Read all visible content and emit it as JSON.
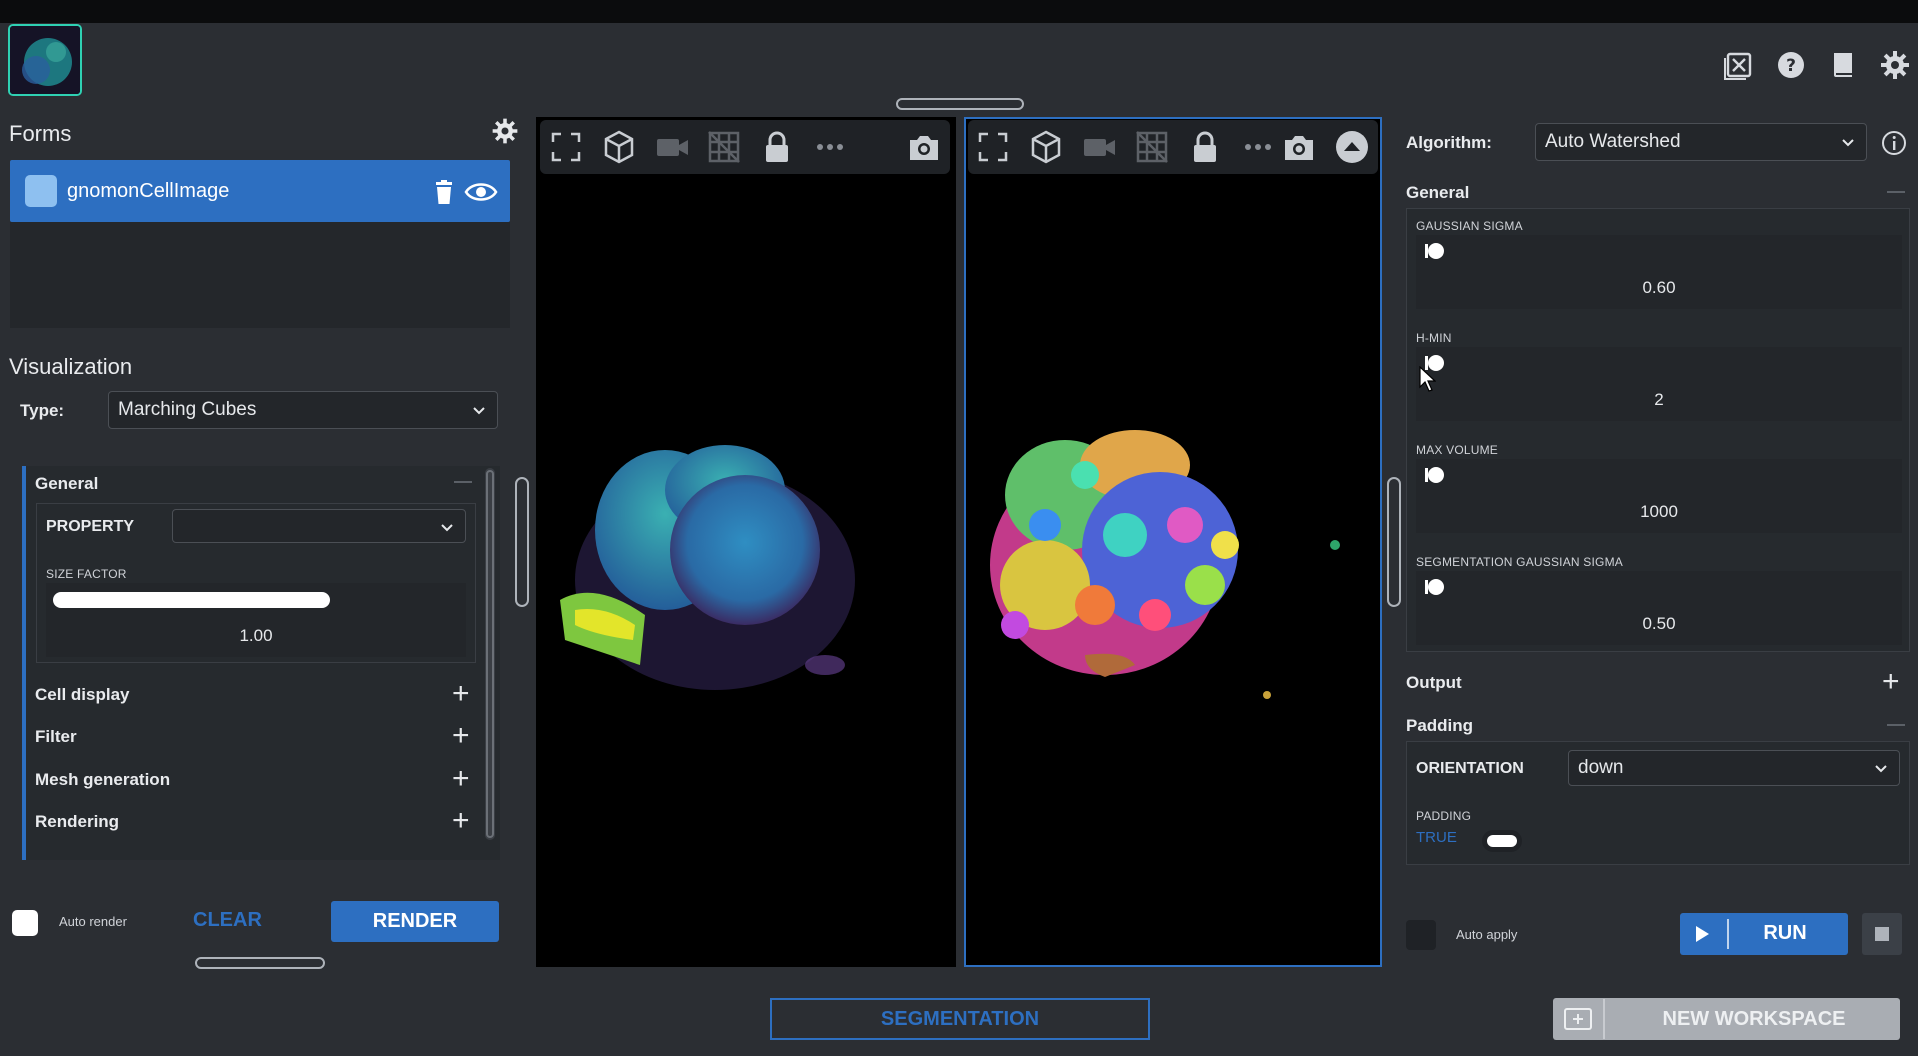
{
  "header": {
    "icons": [
      "close-workspace-icon",
      "help-icon",
      "book-icon",
      "settings-icon"
    ]
  },
  "forms": {
    "title": "Forms",
    "item_label": "gnomonCellImage"
  },
  "visualization": {
    "title": "Visualization",
    "type_label": "Type:",
    "type_value": "Marching Cubes",
    "general_title": "General",
    "property_label": "PROPERTY",
    "property_value": "",
    "size_factor_label": "SIZE FACTOR",
    "size_factor_value": "1.00",
    "size_factor_fraction": 0.6,
    "sections": [
      "Cell display",
      "Filter",
      "Mesh generation",
      "Rendering"
    ],
    "auto_render_label": "Auto render",
    "clear_label": "CLEAR",
    "render_label": "RENDER"
  },
  "algorithm": {
    "label": "Algorithm:",
    "value": "Auto Watershed",
    "general_title": "General",
    "params": [
      {
        "label": "GAUSSIAN SIGMA",
        "value": "0.60"
      },
      {
        "label": "H-MIN",
        "value": "2"
      },
      {
        "label": "MAX VOLUME",
        "value": "1000"
      },
      {
        "label": "SEGMENTATION GAUSSIAN SIGMA",
        "value": "0.50"
      }
    ],
    "output_title": "Output",
    "padding_title": "Padding",
    "orientation_label": "ORIENTATION",
    "orientation_value": "down",
    "padding_label": "PADDING",
    "padding_value": "TRUE",
    "auto_apply_label": "Auto apply",
    "run_label": "RUN"
  },
  "footer": {
    "segmentation_label": "SEGMENTATION",
    "new_workspace_label": "NEW WORKSPACE"
  },
  "colors": {
    "accent": "#2d6fc1",
    "thumb_border": "#2fd1b3",
    "background": "#2b2e33"
  }
}
